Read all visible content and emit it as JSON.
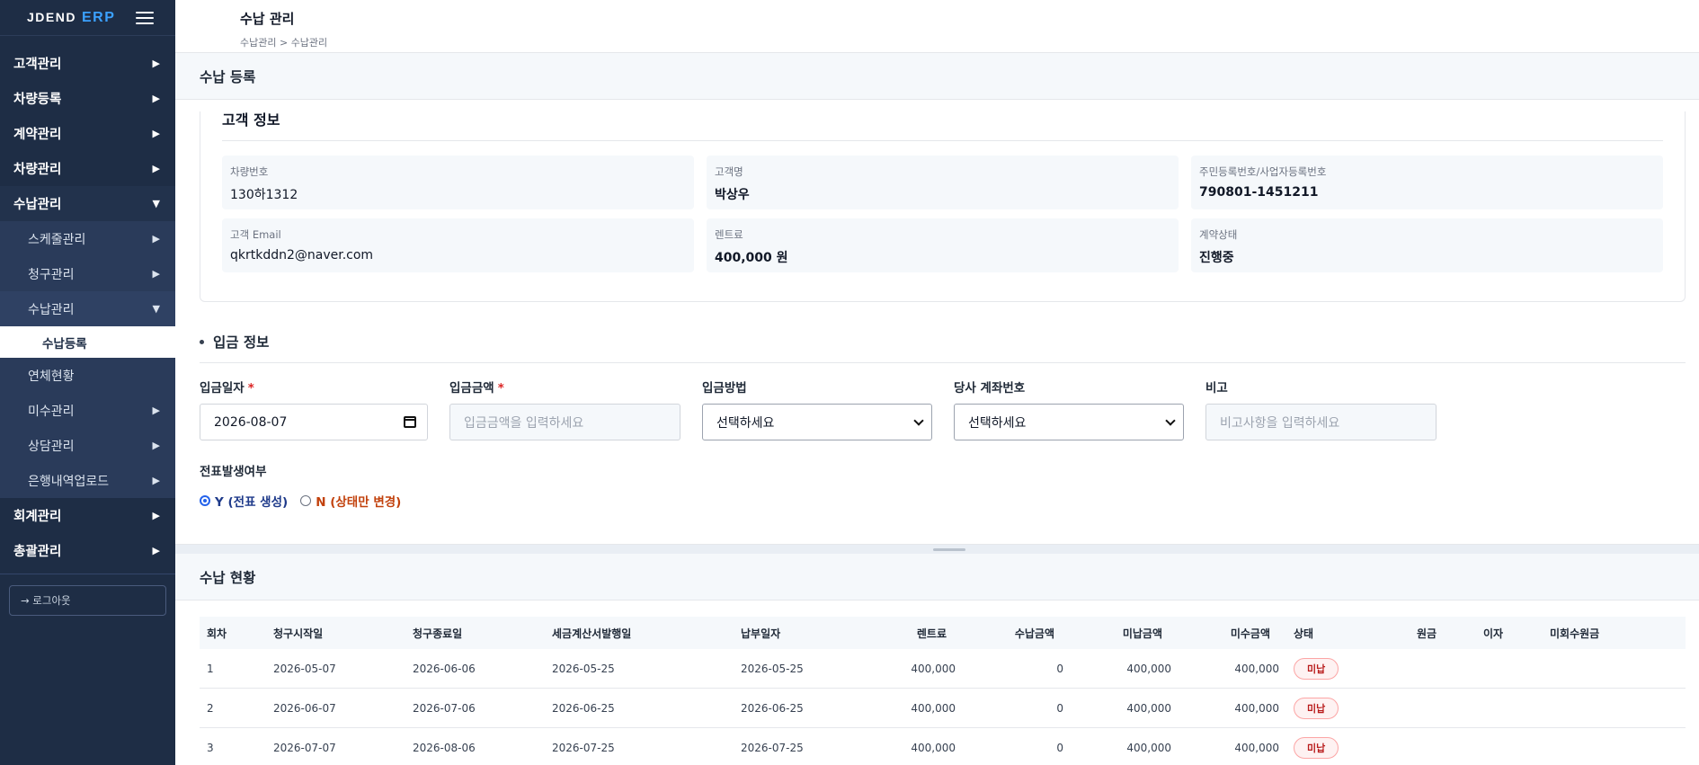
{
  "brand": {
    "name": "JDEND",
    "accent": "ERP"
  },
  "sidebar": {
    "items": [
      {
        "label": "고객관리"
      },
      {
        "label": "차량등록"
      },
      {
        "label": "계약관리"
      },
      {
        "label": "차량관리"
      },
      {
        "label": "수납관리"
      }
    ],
    "sub_items": [
      {
        "label": "스케줄관리"
      },
      {
        "label": "청구관리"
      },
      {
        "label": "수납관리"
      }
    ],
    "sub_sub_active": "수납등록",
    "sub_items_after": [
      {
        "label": "연체현황"
      },
      {
        "label": "미수관리"
      },
      {
        "label": "상담관리"
      },
      {
        "label": "은행내역업로드"
      }
    ],
    "items_after": [
      {
        "label": "회계관리"
      },
      {
        "label": "총괄관리"
      }
    ],
    "logout": "→ 로그아웃"
  },
  "header": {
    "title": "수납 관리",
    "breadcrumb": "수납관리 > 수납관리"
  },
  "register_section": {
    "title": "수납 등록"
  },
  "customer": {
    "title": "고객 정보",
    "fields": [
      {
        "label": "차량번호",
        "value": "130하1312"
      },
      {
        "label": "고객명",
        "value": "박상우"
      },
      {
        "label": "주민등록번호/사업자등록번호",
        "value": "790801-1451211"
      },
      {
        "label": "고객 Email",
        "value": "qkrtkddn2@naver.com"
      },
      {
        "label": "렌트료",
        "value": "400,000 원"
      },
      {
        "label": "계약상태",
        "value": "진행중"
      }
    ]
  },
  "deposit": {
    "title": "입금 정보",
    "date_label": "입금일자",
    "date_value": "2026-08-07",
    "amount_label": "입금금액",
    "amount_placeholder": "입금금액을 입력하세요",
    "method_label": "입금방법",
    "method_value": "선택하세요",
    "account_label": "당사 계좌번호",
    "account_value": "선택하세요",
    "memo_label": "비고",
    "memo_placeholder": "비고사항을 입력하세요",
    "required_mark": "*",
    "voucher_label": "전표발생여부",
    "voucher_y": "Y (전표 생성)",
    "voucher_n": "N (상태만 변경)"
  },
  "status_section": {
    "title": "수납 현황"
  },
  "table": {
    "headers": [
      "회차",
      "청구시작일",
      "청구종료일",
      "세금계산서발행일",
      "납부일자",
      "렌트료",
      "수납금액",
      "미납금액",
      "미수금액",
      "상태",
      "원금",
      "이자",
      "미회수원금"
    ],
    "rows": [
      [
        "1",
        "2026-05-07",
        "2026-06-06",
        "2026-05-25",
        "2026-05-25",
        "400,000",
        "0",
        "400,000",
        "400,000",
        "미납",
        "",
        "",
        ""
      ],
      [
        "2",
        "2026-06-07",
        "2026-07-06",
        "2026-06-25",
        "2026-06-25",
        "400,000",
        "0",
        "400,000",
        "400,000",
        "미납",
        "",
        "",
        ""
      ],
      [
        "3",
        "2026-07-07",
        "2026-08-06",
        "2026-07-25",
        "2026-07-25",
        "400,000",
        "0",
        "400,000",
        "400,000",
        "미납",
        "",
        "",
        ""
      ]
    ]
  },
  "colors": {
    "sidebar_bg": "#1e2d45",
    "accent": "#3ba1ff",
    "required": "#dc2626",
    "badge_red": "#b91c1c"
  }
}
